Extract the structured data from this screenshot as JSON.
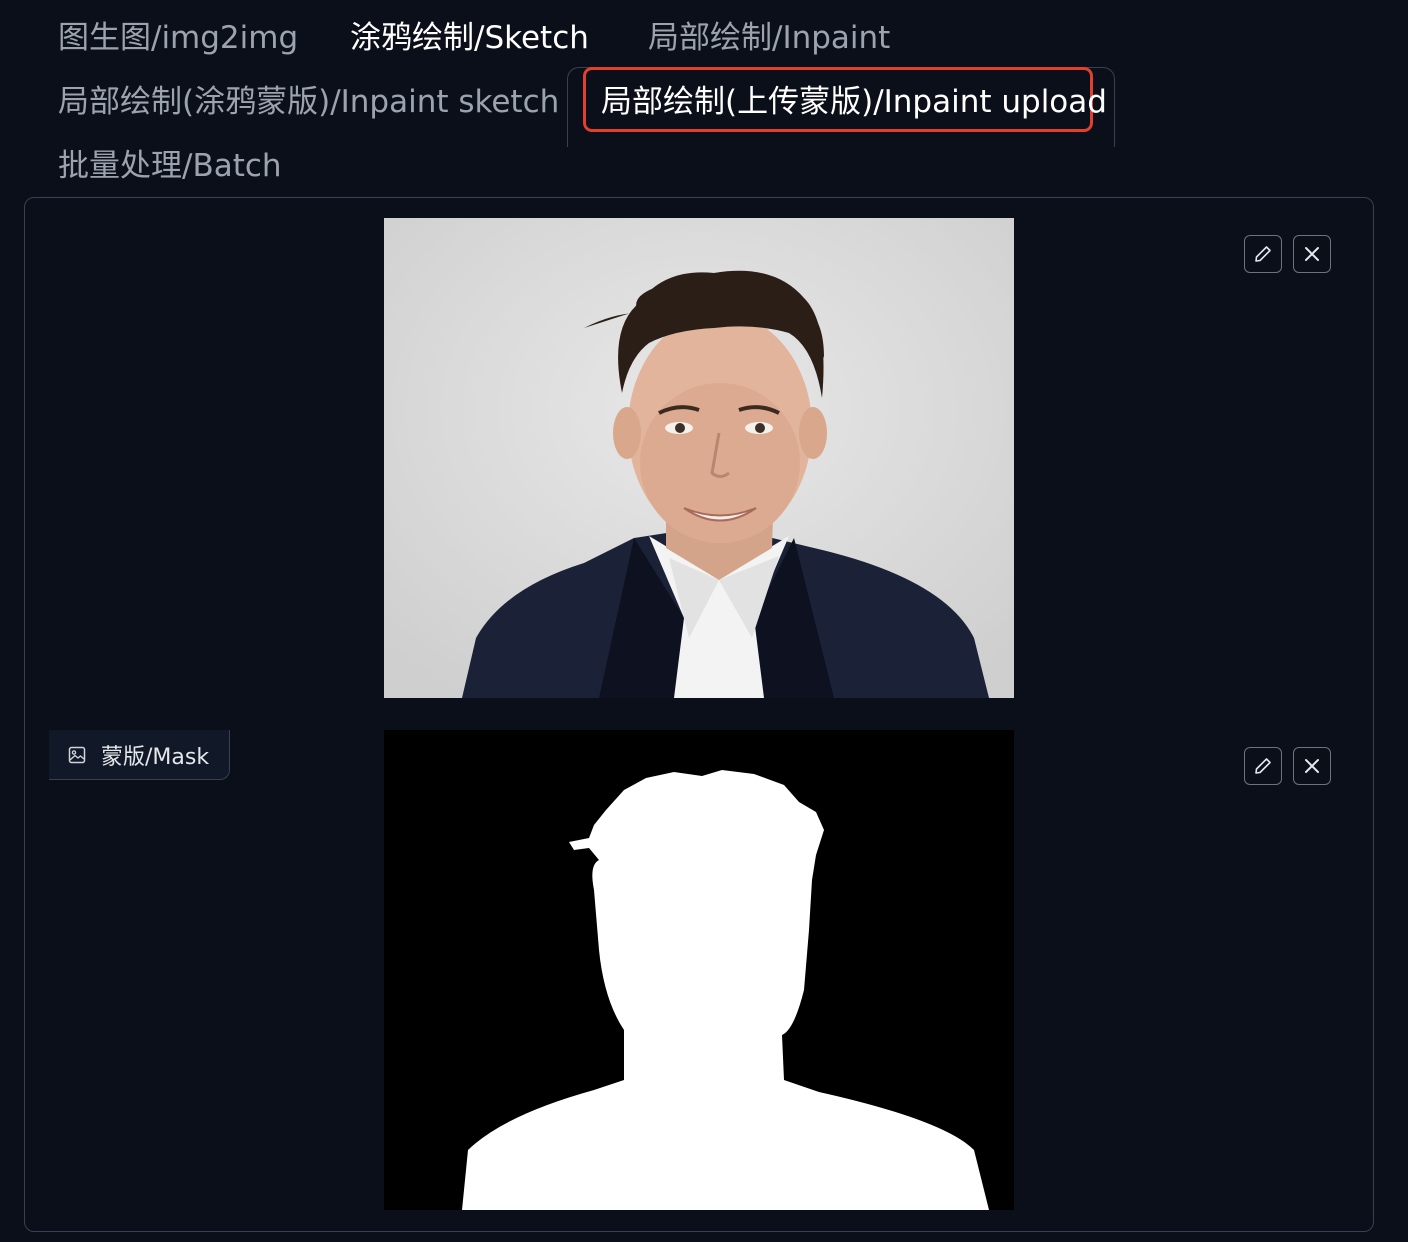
{
  "tabs": [
    {
      "label": "图生图/img2img"
    },
    {
      "label": "涂鸦绘制/Sketch"
    },
    {
      "label": "局部绘制/Inpaint"
    },
    {
      "label": "局部绘制(涂鸦蒙版)/Inpaint sketch"
    },
    {
      "label": "局部绘制(上传蒙版)/Inpaint upload"
    },
    {
      "label": "批量处理/Batch"
    }
  ],
  "active_tab_index": 4,
  "highlight_color": "#e0402d",
  "image_panel": {
    "image_icons": [
      "pencil-icon",
      "close-icon"
    ]
  },
  "mask_panel": {
    "label": "蒙版/Mask",
    "label_icon": "image-icon",
    "image_icons": [
      "pencil-icon",
      "close-icon"
    ]
  }
}
